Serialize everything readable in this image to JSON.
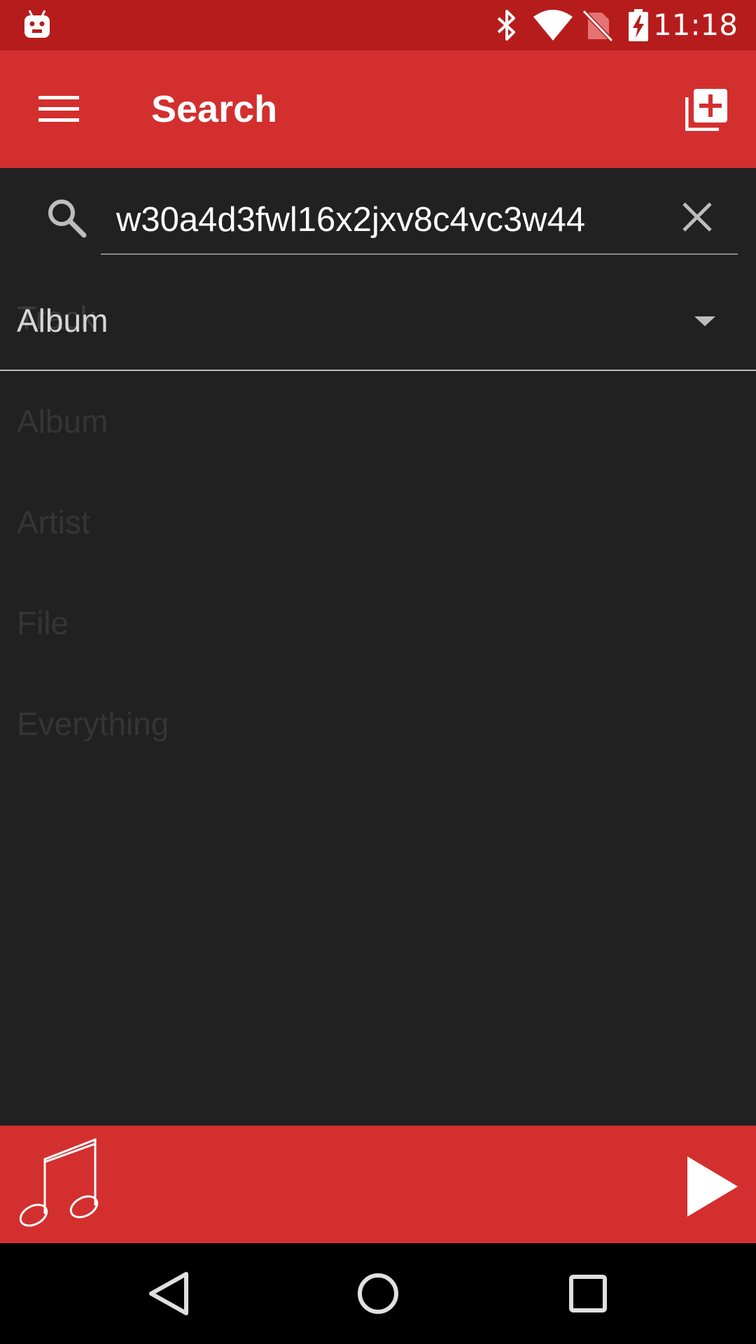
{
  "status_bar": {
    "time": "11:18",
    "icons": [
      "debug-icon",
      "bluetooth-icon",
      "wifi-icon",
      "no-sim-icon",
      "battery-charging-icon"
    ]
  },
  "app_bar": {
    "title": "Search",
    "menu_icon": "hamburger-menu-icon",
    "action_icon": "add-to-queue-icon"
  },
  "search": {
    "query": "w30a4d3fwl16x2jxv8c4vc3w44",
    "icon": "search-icon",
    "clear_icon": "close-icon"
  },
  "spinner": {
    "selected": "Album",
    "ghost_behind": "Track",
    "options": [
      "Album",
      "Artist",
      "File",
      "Everything"
    ]
  },
  "player": {
    "art_icon": "music-note-icon",
    "play_icon": "play-icon"
  },
  "navigation": {
    "icons": [
      "back-icon",
      "home-icon",
      "recents-icon"
    ]
  },
  "colors": {
    "status_bar": "#b71c1c",
    "primary": "#d32f2f",
    "background": "#212121",
    "nav_bar": "#000000"
  }
}
